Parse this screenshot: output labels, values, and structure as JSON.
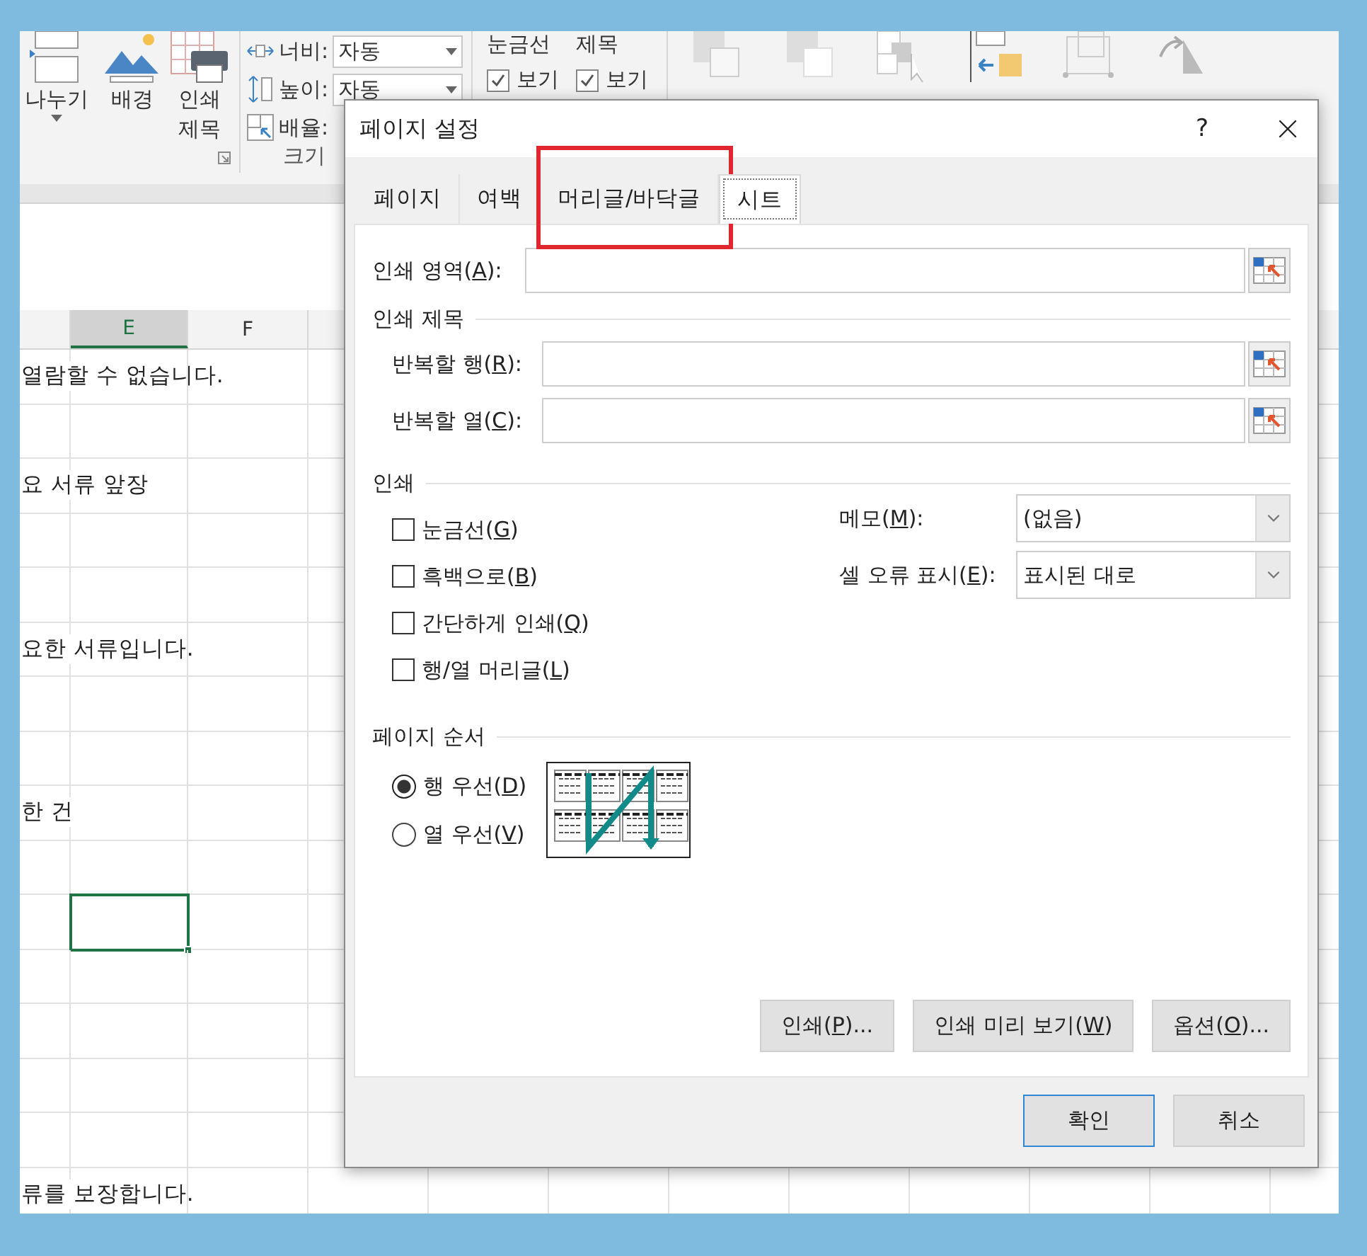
{
  "ribbon": {
    "buttons": [
      {
        "kind": "breaks",
        "lines": [
          "나누기"
        ],
        "caret": true
      },
      {
        "kind": "background",
        "lines": [
          "배경"
        ],
        "caret": false
      },
      {
        "kind": "titles",
        "lines": [
          "인쇄",
          "제목"
        ],
        "caret": false
      }
    ],
    "scale_fields": [
      {
        "kind": "width",
        "label": "너비:",
        "value": "자동"
      },
      {
        "kind": "height",
        "label": "높이:",
        "value": "자동"
      },
      {
        "kind": "scale",
        "label": "배율:"
      }
    ],
    "scale_group_label": "크기",
    "sheet_options": [
      {
        "title": "눈금선",
        "checkbox": {
          "label": "보기",
          "checked": true
        }
      },
      {
        "title": "제목",
        "checkbox": {
          "label": "보기",
          "checked": true
        }
      }
    ]
  },
  "sheet": {
    "columns": [
      {
        "label": "E",
        "selected": true
      },
      {
        "label": "F",
        "selected": false
      }
    ],
    "rows": [
      {
        "text": "열람할 수 없습니다."
      },
      {},
      {
        "text": "요 서류 앞장"
      },
      {},
      {},
      {
        "text": "요한 서류입니다."
      },
      {},
      {},
      {
        "text": "한 건"
      },
      {},
      {
        "active_cell": true
      },
      {},
      {},
      {},
      {},
      {
        "text": "류를 보장합니다."
      }
    ]
  },
  "dialog": {
    "title": "페이지 설정",
    "help": "?",
    "tabs": [
      {
        "label": "페이지",
        "selected": false,
        "highlighted": false
      },
      {
        "label": "여백",
        "selected": false,
        "highlighted": false
      },
      {
        "label": "머리글/바닥글",
        "selected": false,
        "highlighted": true
      },
      {
        "label": "시트",
        "selected": true,
        "highlighted": false
      }
    ],
    "print_area": {
      "label": [
        "인쇄 영역(",
        "A",
        "):"
      ]
    },
    "print_titles": {
      "title": "인쇄 제목",
      "fields": [
        {
          "label": [
            "반복할 행(",
            "R",
            "):"
          ]
        },
        {
          "label": [
            "반복할 열(",
            "C",
            "):"
          ]
        }
      ]
    },
    "print": {
      "title": "인쇄",
      "checkboxes": [
        {
          "label": [
            "눈금선(",
            "G",
            ")"
          ],
          "checked": false
        },
        {
          "label": [
            "흑백으로(",
            "B",
            ")"
          ],
          "checked": false
        },
        {
          "label": [
            "간단하게 인쇄(",
            "Q",
            ")"
          ],
          "checked": false
        },
        {
          "label": [
            "행/열 머리글(",
            "L",
            ")"
          ],
          "checked": false
        }
      ],
      "dropdowns": [
        {
          "label": [
            "메모(",
            "M",
            "):"
          ],
          "value": "(없음)"
        },
        {
          "label": [
            "셀 오류 표시(",
            "E",
            "):"
          ],
          "value": "표시된 대로"
        }
      ]
    },
    "page_order": {
      "title": "페이지 순서",
      "options": [
        {
          "label": [
            "행 우선(",
            "D",
            ")"
          ],
          "selected": true
        },
        {
          "label": [
            "열 우선(",
            "V",
            ")"
          ],
          "selected": false
        }
      ]
    },
    "action_buttons": [
      {
        "label": [
          "인쇄(",
          "P",
          ")..."
        ]
      },
      {
        "label": [
          "인쇄 미리 보기(",
          "W",
          ")"
        ]
      },
      {
        "label": [
          "옵션(",
          "O",
          ")..."
        ]
      }
    ],
    "footer_buttons": [
      {
        "label": "확인",
        "default": true
      },
      {
        "label": "취소",
        "default": false
      }
    ]
  }
}
